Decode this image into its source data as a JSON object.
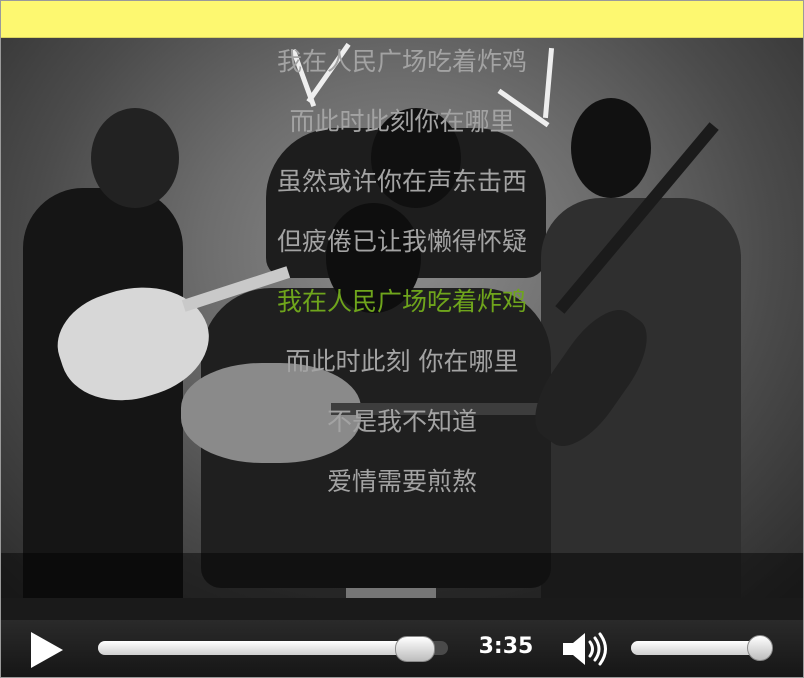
{
  "lyrics": [
    {
      "text": "我在人民广场吃着炸鸡",
      "active": false
    },
    {
      "text": "而此时此刻你在哪里",
      "active": false
    },
    {
      "text": "虽然或许你在声东击西",
      "active": false
    },
    {
      "text": "但疲倦已让我懒得怀疑",
      "active": false
    },
    {
      "text": "我在人民广场吃着炸鸡",
      "active": true
    },
    {
      "text": "而此时此刻 你在哪里",
      "active": false
    },
    {
      "text": "不是我不知道",
      "active": false
    },
    {
      "text": "爱情需要煎熬",
      "active": false
    }
  ],
  "player": {
    "time": "3:35",
    "progress_fraction": 0.95,
    "volume_fraction": 0.93,
    "play_icon": "play-icon",
    "volume_icon": "volume-icon"
  },
  "colors": {
    "top_bar": "#fdf870",
    "active_lyric": "#6fa51c",
    "inactive_lyric": "#a3a3a3"
  }
}
